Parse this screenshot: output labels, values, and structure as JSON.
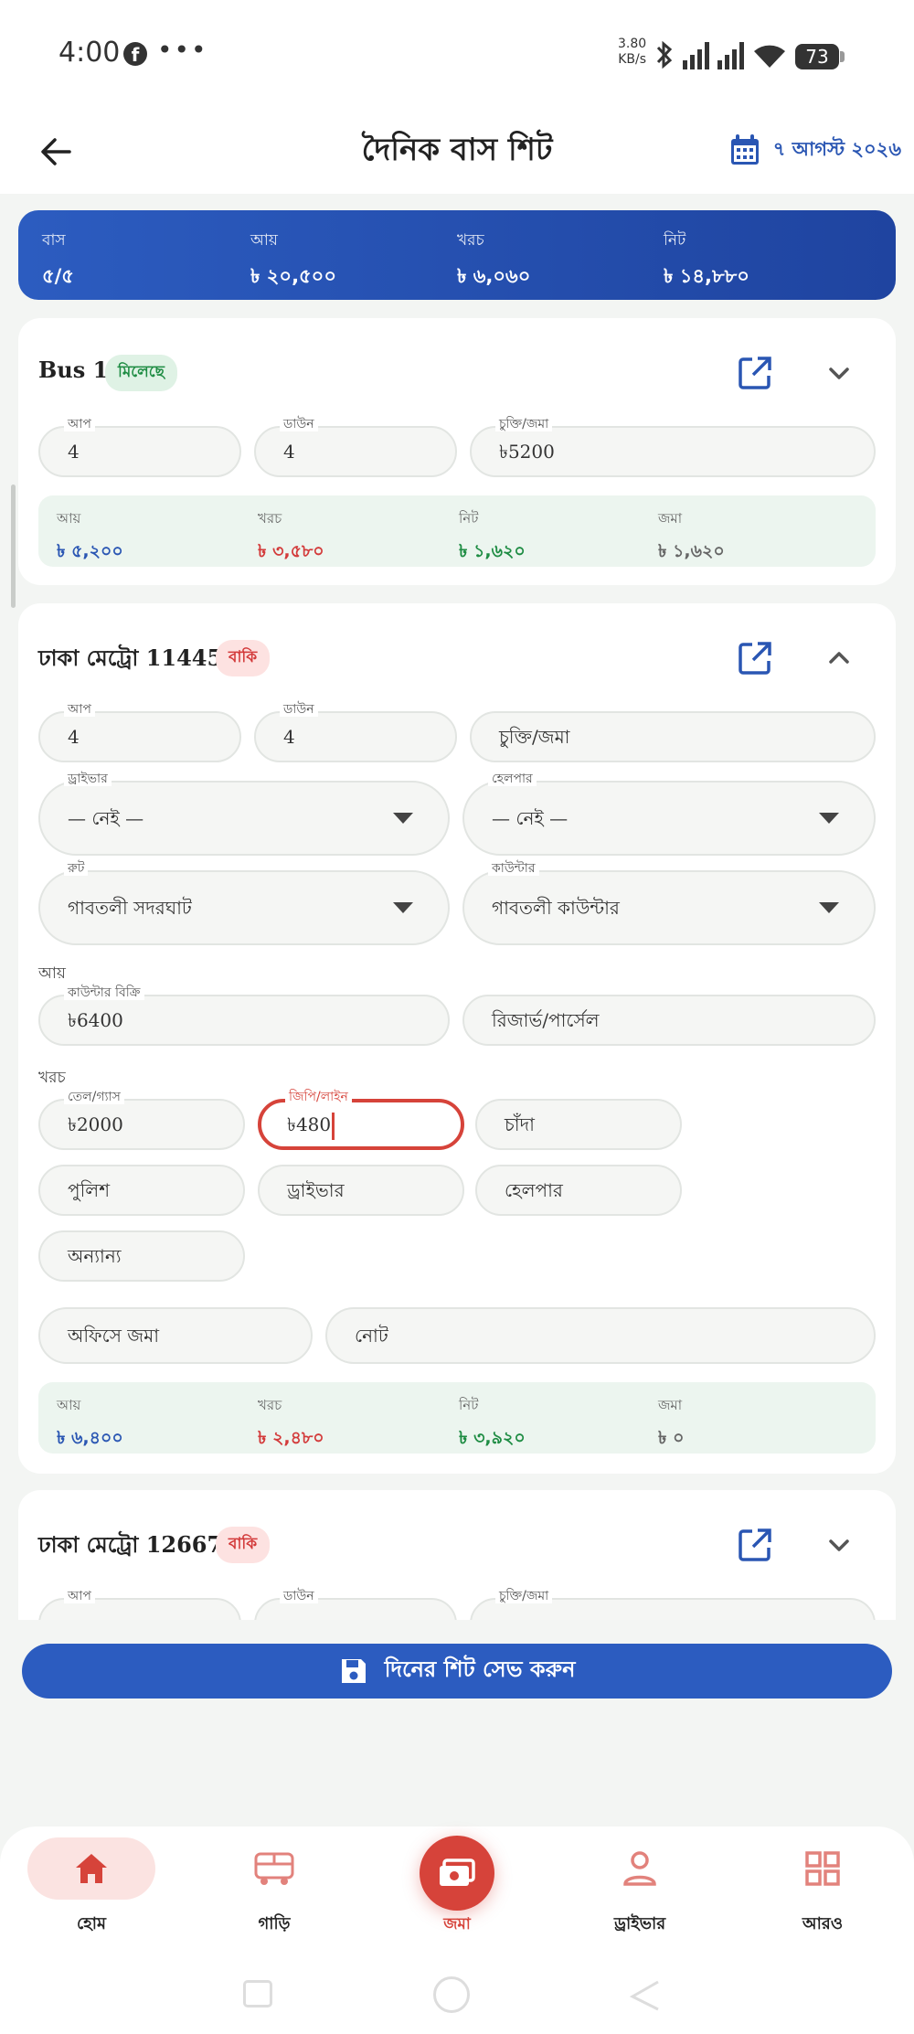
{
  "status_bar": {
    "time": "4:00",
    "speed_value": "3.80",
    "speed_unit": "KB/s",
    "battery": "73"
  },
  "header": {
    "title": "দৈনিক বাস শিট",
    "date": "৭ আগস্ট ২০২৬"
  },
  "summary": [
    {
      "label": "বাস",
      "value": "৫/৫"
    },
    {
      "label": "আয়",
      "value": "৳ ২০,৫০০"
    },
    {
      "label": "খরচ",
      "value": "৳ ৬,০৬০"
    },
    {
      "label": "নিট",
      "value": "৳ ১৪,৮৮০"
    }
  ],
  "bus1": {
    "title": "Bus 1",
    "badge": "মিলেছে",
    "up_label": "আপ",
    "up": "4",
    "down_label": "ডাউন",
    "down": "4",
    "contract_label": "চুক্তি/জমা",
    "contract": "৳5200",
    "totals": [
      {
        "label": "আয়",
        "value": "৳ ৫,২০০"
      },
      {
        "label": "খরচ",
        "value": "৳ ৩,৫৮০"
      },
      {
        "label": "নিট",
        "value": "৳ ১,৬২০"
      },
      {
        "label": "জমা",
        "value": "৳ ১,৬২০"
      }
    ]
  },
  "bus2": {
    "title": "ঢাকা মেট্রো 114455",
    "badge": "বাকি",
    "up_label": "আপ",
    "up": "4",
    "down_label": "ডাউন",
    "down": "4",
    "contract_placeholder": "চুক্তি/জমা",
    "driver_label": "ড্রাইভার",
    "driver": "— নেই —",
    "helper_label": "হেলপার",
    "helper": "— নেই —",
    "route_label": "রুট",
    "route": "গাবতলী সদরঘাট",
    "counter_label": "কাউন্টার",
    "counter": "গাবতলী কাউন্টার",
    "income_section": "আয়",
    "counter_sale_label": "কাউন্টার বিক্রি",
    "counter_sale": "৳6400",
    "reserve_placeholder": "রিজার্ভ/পার্সেল",
    "expense_section": "খরচ",
    "fuel_label": "তেল/গ্যাস",
    "fuel": "৳2000",
    "gp_label": "জিপি/লাইন",
    "gp": "৳480",
    "chanda": "চাঁদা",
    "police": "পুলিশ",
    "driver_pay": "ড্রাইভার",
    "helper_pay": "হেলপার",
    "other": "অন্যান্য",
    "office_deposit": "অফিসে জমা",
    "note": "নোট",
    "totals": [
      {
        "label": "আয়",
        "value": "৳ ৬,৪০০"
      },
      {
        "label": "খরচ",
        "value": "৳ ২,৪৮০"
      },
      {
        "label": "নিট",
        "value": "৳ ৩,৯২০"
      },
      {
        "label": "জমা",
        "value": "৳ ০"
      }
    ]
  },
  "bus3": {
    "title": "ঢাকা মেট্রো 126677",
    "badge": "বাকি",
    "up_label": "আপ",
    "down_label": "ডাউন",
    "contract_label": "চুক্তি/জমা"
  },
  "save_button": "দিনের শিট সেভ করুন",
  "nav": {
    "home": "হোম",
    "vehicles": "গাড়ি",
    "deposit": "জমা",
    "driver": "ড্রাইভার",
    "more": "আরও"
  },
  "colors": {
    "primary": "#2c5cc0",
    "accent": "#d6433a",
    "success": "#1e8c43"
  }
}
